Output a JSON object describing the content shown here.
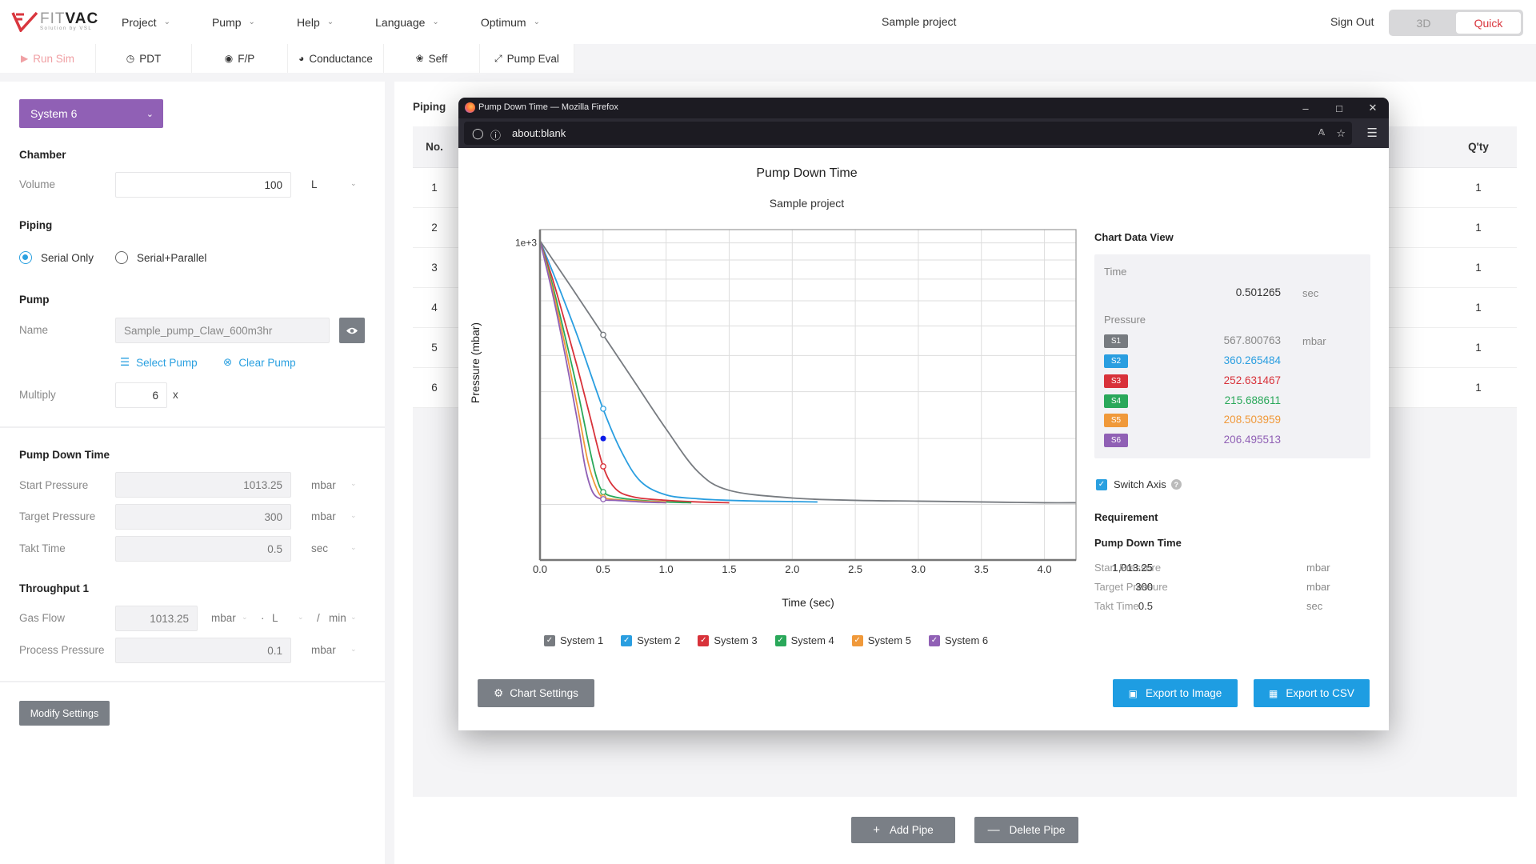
{
  "app": {
    "logo": {
      "word_light": "FIT",
      "word_bold": "VAC",
      "tagline": "Solution by VSL"
    },
    "nav": [
      {
        "label": "Project"
      },
      {
        "label": "Pump"
      },
      {
        "label": "Help"
      },
      {
        "label": "Language"
      },
      {
        "label": "Optimum"
      }
    ],
    "project_title": "Sample project",
    "sign_out": "Sign Out",
    "mode_toggle": {
      "options": [
        "3D",
        "Quick"
      ],
      "selected": "Quick"
    },
    "accent_color": "#d9363e"
  },
  "toolbar": [
    {
      "label": "Run Sim",
      "icon": "play-icon",
      "disabled": true
    },
    {
      "label": "PDT",
      "icon": "clock-icon"
    },
    {
      "label": "F/P",
      "icon": "gauge-icon"
    },
    {
      "label": "Conductance",
      "icon": "conductance-icon"
    },
    {
      "label": "Seff",
      "icon": "fan-icon"
    },
    {
      "label": "Pump Eval",
      "icon": "compress-arrows-icon"
    }
  ],
  "left": {
    "system_select": {
      "value": "System 6",
      "color": "#9060b5"
    },
    "chamber": {
      "title": "Chamber",
      "volume_label": "Volume",
      "volume_value": "100",
      "volume_unit": "L"
    },
    "piping": {
      "title": "Piping",
      "options": [
        "Serial Only",
        "Serial+Parallel"
      ],
      "selected": "Serial Only"
    },
    "pump": {
      "title": "Pump",
      "name_label": "Name",
      "name_value": "Sample_pump_Claw_600m3hr",
      "select_pump": "Select Pump",
      "clear_pump": "Clear Pump",
      "multiply_label": "Multiply",
      "multiply_value": "6",
      "multiply_suffix": "x"
    },
    "pump_down_time": {
      "title": "Pump Down Time",
      "start_label": "Start Pressure",
      "start_value": "1013.25",
      "start_unit": "mbar",
      "target_label": "Target Pressure",
      "target_value": "300",
      "target_unit": "mbar",
      "takt_label": "Takt Time",
      "takt_value": "0.5",
      "takt_unit": "sec"
    },
    "throughput": {
      "title": "Throughput 1",
      "gas_label": "Gas Flow",
      "gas_value": "1013.25",
      "gas_unit1": "mbar",
      "gas_dot": "·",
      "gas_unit2": "L",
      "gas_slash": "/",
      "gas_unit3": "min",
      "process_label": "Process Pressure",
      "process_value": "0.1",
      "process_unit": "mbar"
    },
    "modify_button": "Modify Settings"
  },
  "main": {
    "piping_label": "Piping",
    "table": {
      "col_no": "No.",
      "col_qty": "Q'ty",
      "rows": [
        {
          "no": "1",
          "qty": "1"
        },
        {
          "no": "2",
          "qty": "1"
        },
        {
          "no": "3",
          "qty": "1"
        },
        {
          "no": "4",
          "qty": "1"
        },
        {
          "no": "5",
          "qty": "1"
        },
        {
          "no": "6",
          "qty": "1"
        }
      ]
    },
    "add_pipe": "Add Pipe",
    "delete_pipe": "Delete Pipe"
  },
  "popup": {
    "window_title": "Pump Down Time — Mozilla Firefox",
    "url": "about:blank",
    "chart_settings": "Chart Settings",
    "export_image": "Export to Image",
    "export_csv": "Export to CSV",
    "data_view": {
      "title": "Chart Data View",
      "time_label": "Time",
      "time_value": "0.501265",
      "time_unit": "sec",
      "pressure_label": "Pressure",
      "pressure_unit": "mbar",
      "rows": [
        {
          "badge": "S1",
          "value": "567.800763",
          "color": "#777b80"
        },
        {
          "badge": "S2",
          "value": "360.265484",
          "color": "#2a9ee0"
        },
        {
          "badge": "S3",
          "value": "252.631467",
          "color": "#d8323a"
        },
        {
          "badge": "S4",
          "value": "215.688611",
          "color": "#2aa85a"
        },
        {
          "badge": "S5",
          "value": "208.503959",
          "color": "#f0993a"
        },
        {
          "badge": "S6",
          "value": "206.495513",
          "color": "#9060b5"
        }
      ]
    },
    "switch_axis": {
      "label": "Switch Axis",
      "checked": true
    },
    "requirement": {
      "title": "Requirement",
      "subtitle": "Pump Down Time",
      "rows": [
        {
          "label": "Start Pressure",
          "value": "1,013.25",
          "unit": "mbar"
        },
        {
          "label": "Target Pressure",
          "value": "300",
          "unit": "mbar"
        },
        {
          "label": "Takt Time",
          "value": "0.5",
          "unit": "sec"
        }
      ]
    }
  },
  "chart_data": {
    "type": "line",
    "title": "Pump Down Time",
    "subtitle": "Sample project",
    "xlabel": "Time (sec)",
    "ylabel": "Pressure (mbar)",
    "xlim": [
      0,
      4.25
    ],
    "ylim": [
      142,
      1085
    ],
    "yscale": "log",
    "x_ticks": [
      "0.0",
      "0.5",
      "1.0",
      "1.5",
      "2.0",
      "2.5",
      "3.0",
      "3.5",
      "4.0"
    ],
    "y_tick_labels": [
      {
        "value": 1000,
        "label": "1e+3"
      }
    ],
    "y_gridlines": [
      1000,
      900,
      800,
      700,
      600,
      500,
      400,
      300,
      200
    ],
    "grid": true,
    "legend": "bottom",
    "cursor": {
      "x": 0.501265,
      "marker_y": 300
    },
    "series": [
      {
        "name": "System 1",
        "color": "#777b80",
        "x": [
          0,
          0.25,
          0.5,
          0.75,
          1.0,
          1.25,
          1.5,
          2.0,
          2.5,
          3.0,
          3.5,
          4.0,
          4.25
        ],
        "y": [
          1013,
          760,
          568,
          425,
          318,
          245,
          218,
          208,
          205,
          204,
          203,
          202,
          202
        ]
      },
      {
        "name": "System 2",
        "color": "#2a9ee0",
        "x": [
          0,
          0.15,
          0.3,
          0.5,
          0.65,
          0.8,
          1.0,
          1.25,
          1.5,
          1.75,
          2.2
        ],
        "y": [
          1013,
          760,
          560,
          360,
          275,
          230,
          212,
          207,
          205,
          204,
          203
        ]
      },
      {
        "name": "System 3",
        "color": "#d8323a",
        "x": [
          0,
          0.1,
          0.2,
          0.3,
          0.4,
          0.5,
          0.6,
          0.75,
          1.0,
          1.25,
          1.5
        ],
        "y": [
          1013,
          800,
          610,
          460,
          340,
          253,
          220,
          209,
          205,
          203,
          202
        ]
      },
      {
        "name": "System 4",
        "color": "#2aa85a",
        "x": [
          0,
          0.1,
          0.2,
          0.3,
          0.4,
          0.45,
          0.5,
          0.6,
          0.8,
          1.0,
          1.2
        ],
        "y": [
          1013,
          770,
          560,
          400,
          275,
          235,
          216,
          209,
          205,
          203,
          202
        ]
      },
      {
        "name": "System 5",
        "color": "#f0993a",
        "x": [
          0,
          0.1,
          0.2,
          0.3,
          0.38,
          0.45,
          0.5,
          0.6,
          0.8,
          1.0
        ],
        "y": [
          1013,
          750,
          530,
          360,
          260,
          220,
          209,
          206,
          204,
          203
        ]
      },
      {
        "name": "System 6",
        "color": "#9060b5",
        "x": [
          0,
          0.1,
          0.2,
          0.3,
          0.36,
          0.42,
          0.5,
          0.6,
          0.8,
          1.0
        ],
        "y": [
          1013,
          730,
          500,
          330,
          250,
          215,
          206,
          205,
          203,
          202
        ]
      }
    ]
  }
}
